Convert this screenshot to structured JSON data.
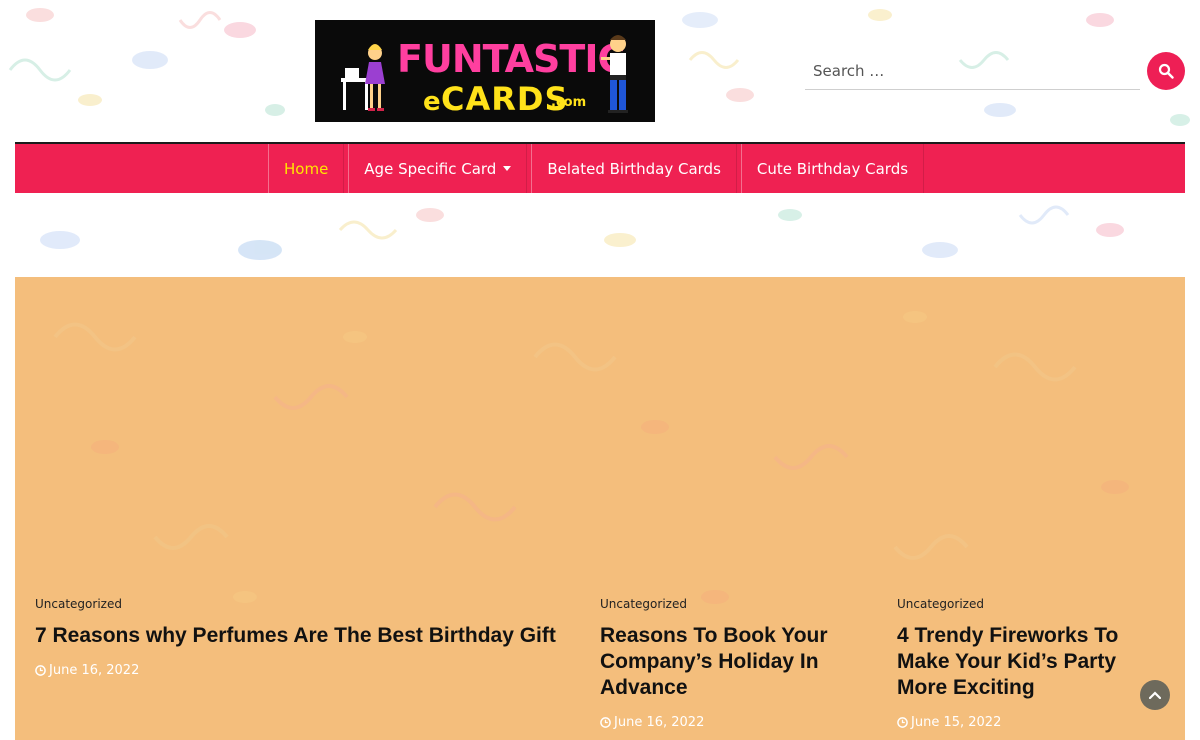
{
  "header": {
    "logo": {
      "text_main": "FUNTASTIC",
      "text_e": "e",
      "text_cards": "CARDS",
      "text_com": ".com"
    },
    "search": {
      "placeholder": "Search …",
      "icon": "search-icon"
    }
  },
  "nav": {
    "items": [
      {
        "label": "Home",
        "active": true
      },
      {
        "label": "Age Specific Card",
        "has_dropdown": true
      },
      {
        "label": "Belated Birthday Cards"
      },
      {
        "label": "Cute Birthday Cards"
      }
    ]
  },
  "posts": [
    {
      "category": "Uncategorized",
      "title": "7 Reasons why Perfumes Are The Best Birthday Gift",
      "date": "June 16, 2022"
    },
    {
      "category": "Uncategorized",
      "title": "Reasons To Book Your Company’s Holiday In Advance",
      "date": "June 16, 2022"
    },
    {
      "category": "Uncategorized",
      "title": "4 Trendy Fireworks To Make Your Kid’s Party More Exciting",
      "date": "June 15, 2022"
    }
  ],
  "colors": {
    "accent": "#ef2152",
    "nav_active": "#ffe600",
    "panel": "#f3b972",
    "back_to_top": "#6e6a5c"
  },
  "back_to_top": {
    "icon": "chevron-up-icon"
  }
}
